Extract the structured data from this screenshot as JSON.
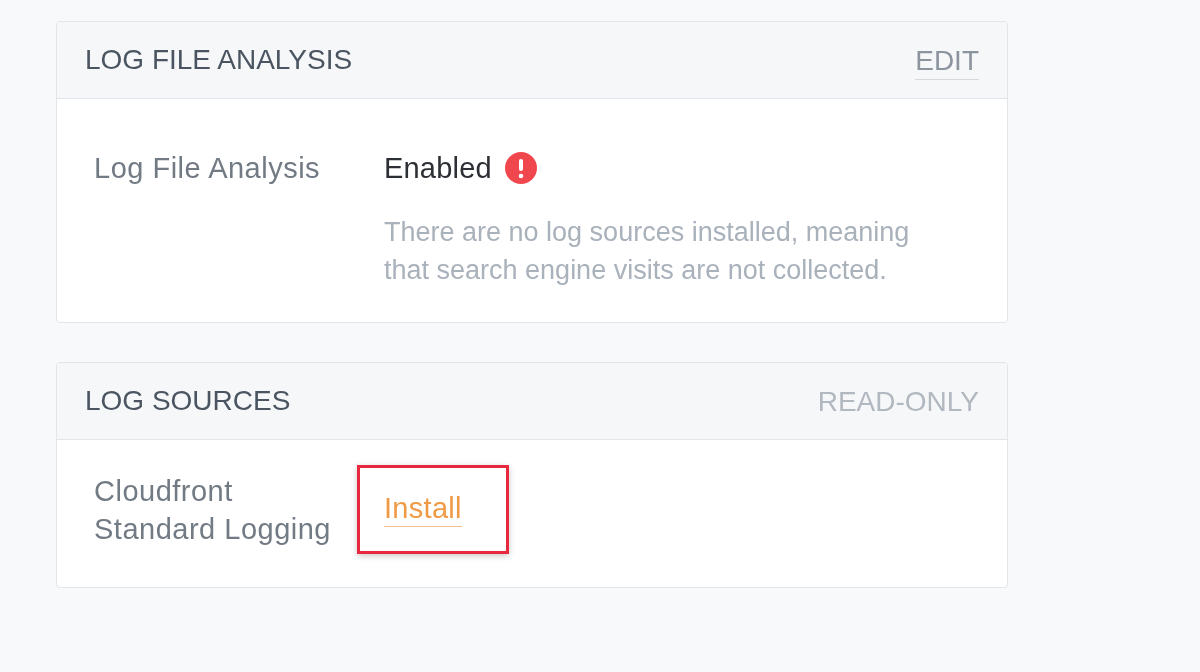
{
  "cards": [
    {
      "title": "LOG FILE ANALYSIS",
      "action": {
        "label": "EDIT",
        "disabled": false
      },
      "rows": [
        {
          "kind": "status",
          "label": "Log File Analysis",
          "value": "Enabled",
          "warning": true,
          "description": "There are no log sources installed, meaning that search engine visits are not collected."
        }
      ]
    },
    {
      "title": "LOG SOURCES",
      "action": {
        "label": "READ-ONLY",
        "disabled": true
      },
      "rows": [
        {
          "kind": "link",
          "label": "Cloudfront Standard Logging",
          "link": "Install",
          "highlighted": true
        }
      ]
    }
  ]
}
